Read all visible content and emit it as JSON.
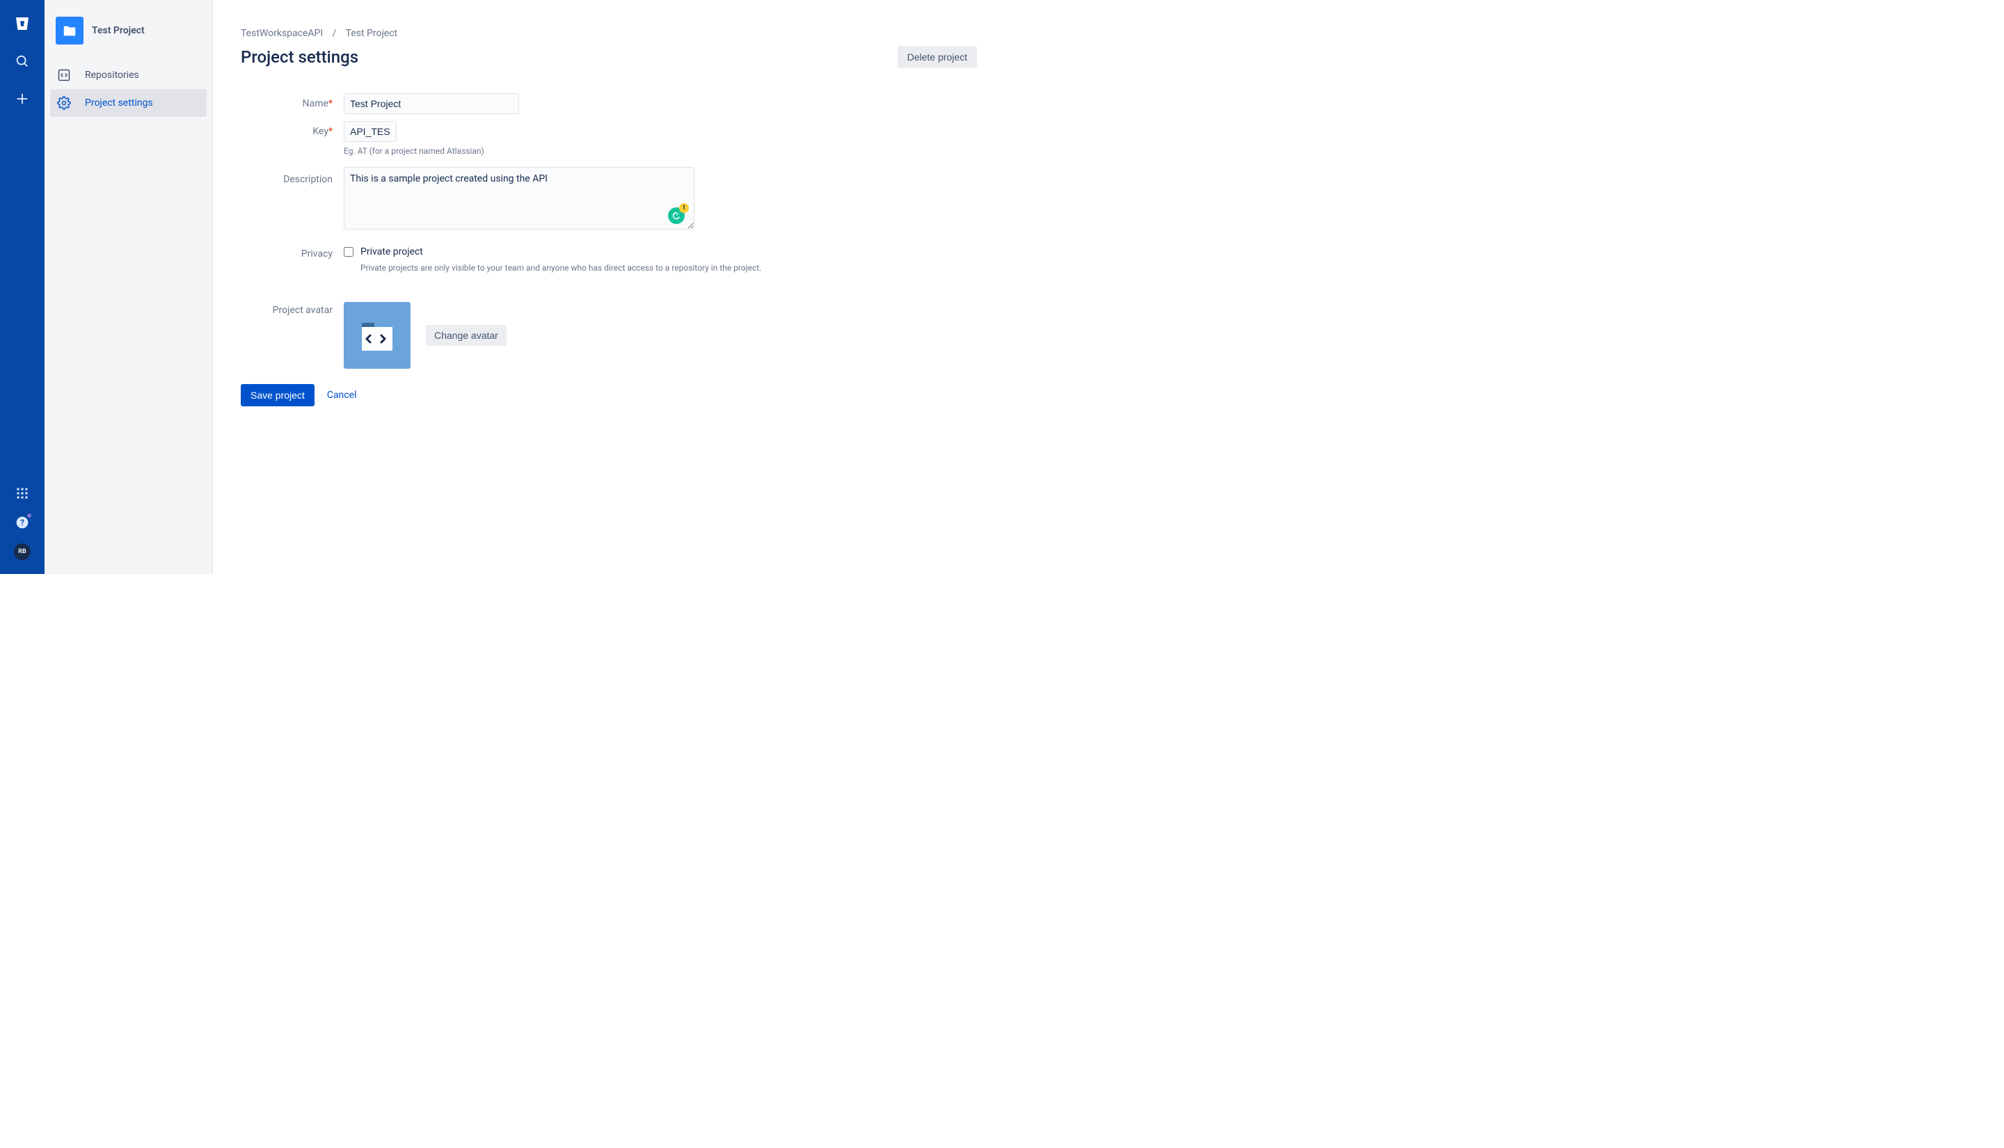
{
  "rail": {
    "avatar_initials": "RB"
  },
  "sidebar": {
    "project_name": "Test Project",
    "items": [
      {
        "label": "Repositories"
      },
      {
        "label": "Project settings"
      }
    ]
  },
  "breadcrumb": {
    "workspace": "TestWorkspaceAPI",
    "project": "Test Project"
  },
  "page_title": "Project settings",
  "delete_button": "Delete project",
  "form": {
    "name_label": "Name",
    "name_value": "Test Project",
    "key_label": "Key",
    "key_value": "API_TEST",
    "key_help": "Eg. AT (for a project named Atlassian)",
    "description_label": "Description",
    "description_value": "This is a sample project created using the API",
    "privacy_label": "Privacy",
    "privacy_checkbox_label": "Private project",
    "privacy_help": "Private projects are only visible to your team and anyone who has direct access to a repository in the project.",
    "avatar_label": "Project avatar",
    "change_avatar": "Change avatar",
    "save": "Save project",
    "cancel": "Cancel",
    "grammarly_badge": "1"
  }
}
